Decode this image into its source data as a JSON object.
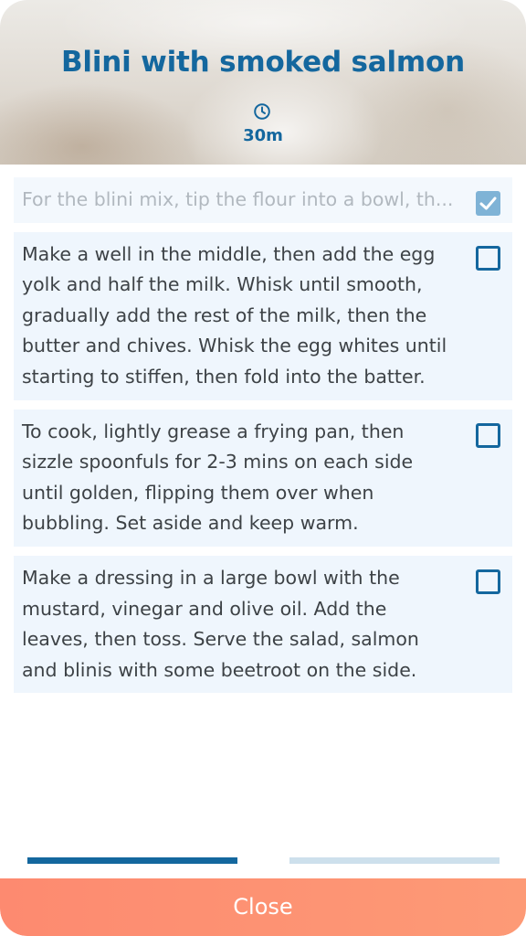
{
  "recipe": {
    "title": "Blini with smoked salmon",
    "time_icon": "clock-icon",
    "time": "30m"
  },
  "steps": [
    {
      "text": "For the blini mix, tip the flour into a bowl, th...",
      "checked": true
    },
    {
      "text": "Make a well in the middle, then add the egg yolk and half the milk. Whisk until smooth, gradually add the rest of the milk, then the butter and chives. Whisk the egg whites until starting to stiffen, then fold into the batter.",
      "checked": false
    },
    {
      "text": "To cook, lightly grease a frying pan, then sizzle spoonfuls for 2-3 mins on each side until golden, flipping them over when bubbling. Set aside and keep warm.",
      "checked": false
    },
    {
      "text": "Make a dressing in a large bowl with the mustard, vinegar and olive oil. Add the leaves, then toss. Serve the salad, salmon and blinis with some beetroot on the side.",
      "checked": false
    }
  ],
  "pager": {
    "pages": 2,
    "current": 1
  },
  "footer": {
    "close_label": "Close"
  },
  "colors": {
    "accent": "#14679e",
    "close_button": "#fd8f72",
    "step_background": "#eff6fd",
    "checked_box": "#7fb3d6"
  }
}
